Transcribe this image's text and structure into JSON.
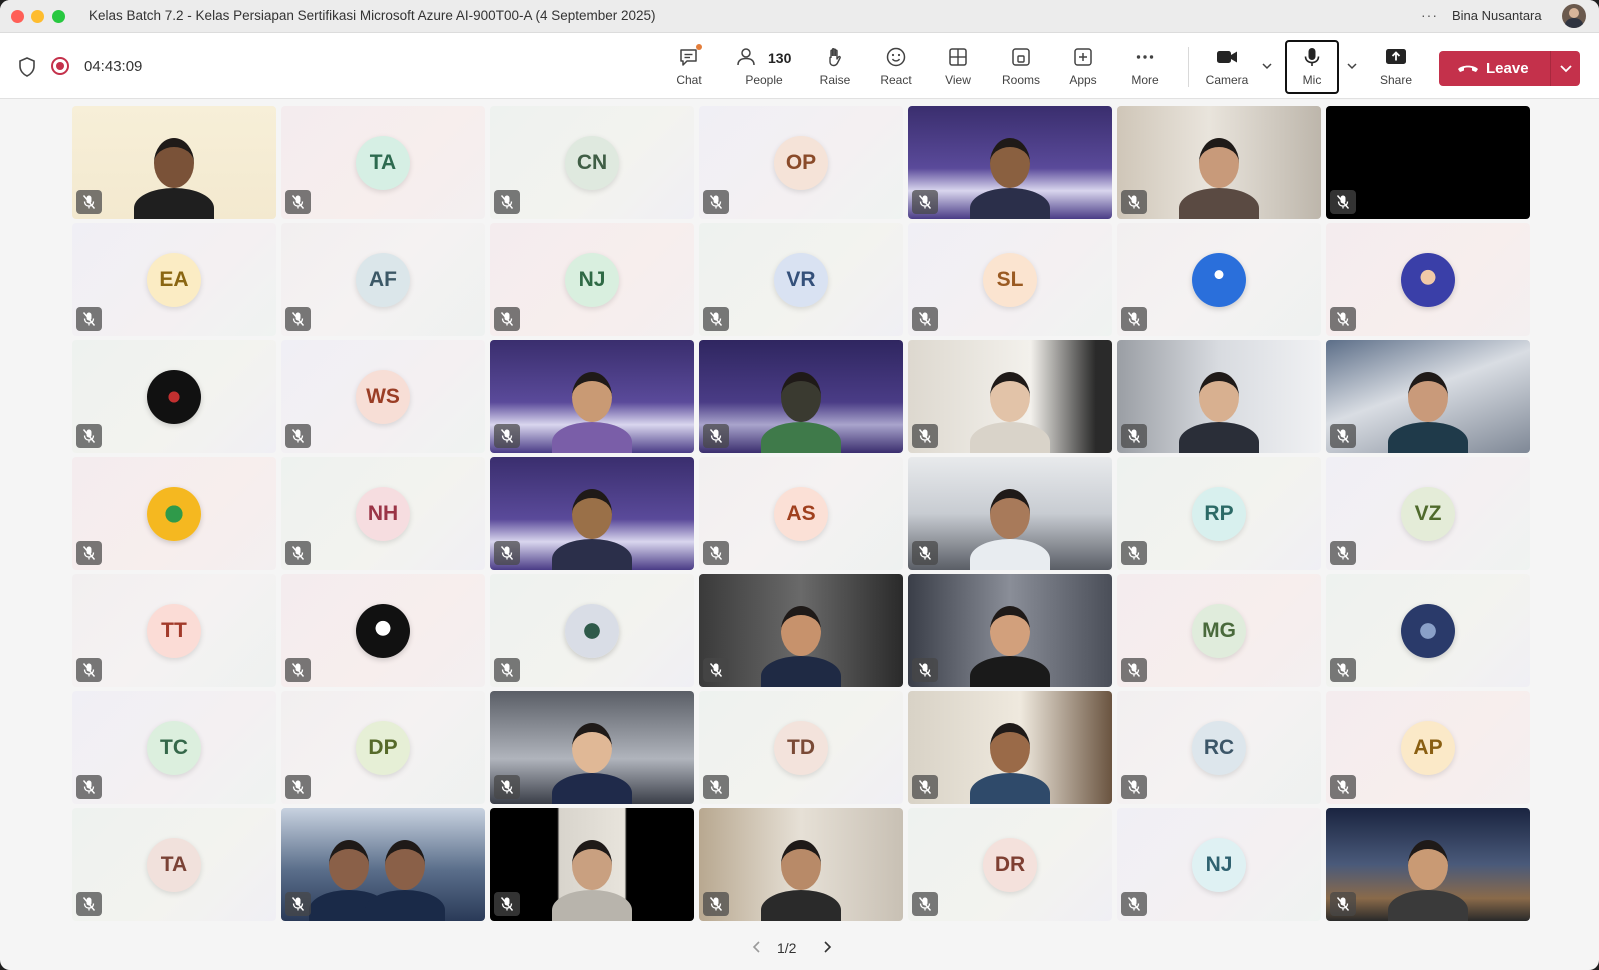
{
  "window": {
    "title": "Kelas Batch 7.2 - Kelas Persiapan Sertifikasi Microsoft Azure AI-900T00-A (4 September 2025)",
    "more": "···",
    "user_name": "Bina Nusantara"
  },
  "toolbar": {
    "timer": "04:43:09",
    "chat": "Chat",
    "people": "People",
    "people_count": "130",
    "raise": "Raise",
    "react": "React",
    "view": "View",
    "rooms": "Rooms",
    "apps": "Apps",
    "more": "More",
    "camera": "Camera",
    "mic": "Mic",
    "share": "Share",
    "leave": "Leave"
  },
  "colors": {
    "leave": "#c4314b",
    "recording": "#c4314b",
    "chat_badge": "#e37d3a"
  },
  "pagination": {
    "label": "1/2"
  },
  "participants": [
    {
      "initials": "",
      "kind": "video"
    },
    {
      "initials": "TA",
      "kind": "initials",
      "bg": "#d6efe4",
      "fg": "#2d6a4f"
    },
    {
      "initials": "CN",
      "kind": "initials",
      "bg": "#dfe9df",
      "fg": "#3f5e45"
    },
    {
      "initials": "OP",
      "kind": "initials",
      "bg": "#f5e3d8",
      "fg": "#8a4b2a"
    },
    {
      "initials": "",
      "kind": "video"
    },
    {
      "initials": "",
      "kind": "video"
    },
    {
      "initials": "",
      "kind": "video"
    },
    {
      "initials": "EA",
      "kind": "initials",
      "bg": "#fbecc4",
      "fg": "#8a6612"
    },
    {
      "initials": "AF",
      "kind": "initials",
      "bg": "#dbe6ea",
      "fg": "#3c5866"
    },
    {
      "initials": "NJ",
      "kind": "initials",
      "bg": "#d9efdf",
      "fg": "#2f6a45"
    },
    {
      "initials": "VR",
      "kind": "initials",
      "bg": "#d9e2f2",
      "fg": "#34507a"
    },
    {
      "initials": "SL",
      "kind": "initials",
      "bg": "#fbe4d0",
      "fg": "#9a5a22"
    },
    {
      "initials": "",
      "kind": "picture"
    },
    {
      "initials": "",
      "kind": "picture"
    },
    {
      "initials": "",
      "kind": "picture"
    },
    {
      "initials": "WS",
      "kind": "initials",
      "bg": "#f7ded6",
      "fg": "#9a3d25"
    },
    {
      "initials": "",
      "kind": "video"
    },
    {
      "initials": "",
      "kind": "video"
    },
    {
      "initials": "",
      "kind": "video"
    },
    {
      "initials": "",
      "kind": "video"
    },
    {
      "initials": "",
      "kind": "video"
    },
    {
      "initials": "",
      "kind": "picture"
    },
    {
      "initials": "NH",
      "kind": "initials",
      "bg": "#f6dde0",
      "fg": "#9a3446"
    },
    {
      "initials": "",
      "kind": "video"
    },
    {
      "initials": "AS",
      "kind": "initials",
      "bg": "#fbe0d6",
      "fg": "#a0401e"
    },
    {
      "initials": "",
      "kind": "video"
    },
    {
      "initials": "RP",
      "kind": "initials",
      "bg": "#d8f0ee",
      "fg": "#2c6a66"
    },
    {
      "initials": "VZ",
      "kind": "initials",
      "bg": "#e4ecd8",
      "fg": "#4f6a2c"
    },
    {
      "initials": "TT",
      "kind": "initials",
      "bg": "#fbdcd6",
      "fg": "#a23a2a"
    },
    {
      "initials": "",
      "kind": "picture"
    },
    {
      "initials": "",
      "kind": "picture"
    },
    {
      "initials": "",
      "kind": "video"
    },
    {
      "initials": "",
      "kind": "video"
    },
    {
      "initials": "MG",
      "kind": "initials",
      "bg": "#e0ecdc",
      "fg": "#4a6a3c"
    },
    {
      "initials": "",
      "kind": "picture"
    },
    {
      "initials": "TC",
      "kind": "initials",
      "bg": "#dcefde",
      "fg": "#35684a"
    },
    {
      "initials": "DP",
      "kind": "initials",
      "bg": "#e6efd6",
      "fg": "#566a2a"
    },
    {
      "initials": "",
      "kind": "video"
    },
    {
      "initials": "TD",
      "kind": "initials",
      "bg": "#f3e3dc",
      "fg": "#7a4a36"
    },
    {
      "initials": "",
      "kind": "video"
    },
    {
      "initials": "RC",
      "kind": "initials",
      "bg": "#dde6ec",
      "fg": "#3c5668"
    },
    {
      "initials": "AP",
      "kind": "initials",
      "bg": "#fbe9c8",
      "fg": "#8a5f12"
    },
    {
      "initials": "TA",
      "kind": "initials",
      "bg": "#f1e1dc",
      "fg": "#7a4236"
    },
    {
      "initials": "",
      "kind": "video"
    },
    {
      "initials": "",
      "kind": "video"
    },
    {
      "initials": "",
      "kind": "video"
    },
    {
      "initials": "DR",
      "kind": "initials",
      "bg": "#f4e1dc",
      "fg": "#7e3f32"
    },
    {
      "initials": "NJ",
      "kind": "initials",
      "bg": "#dff1f3",
      "fg": "#2f6270"
    },
    {
      "initials": "",
      "kind": "video"
    }
  ]
}
